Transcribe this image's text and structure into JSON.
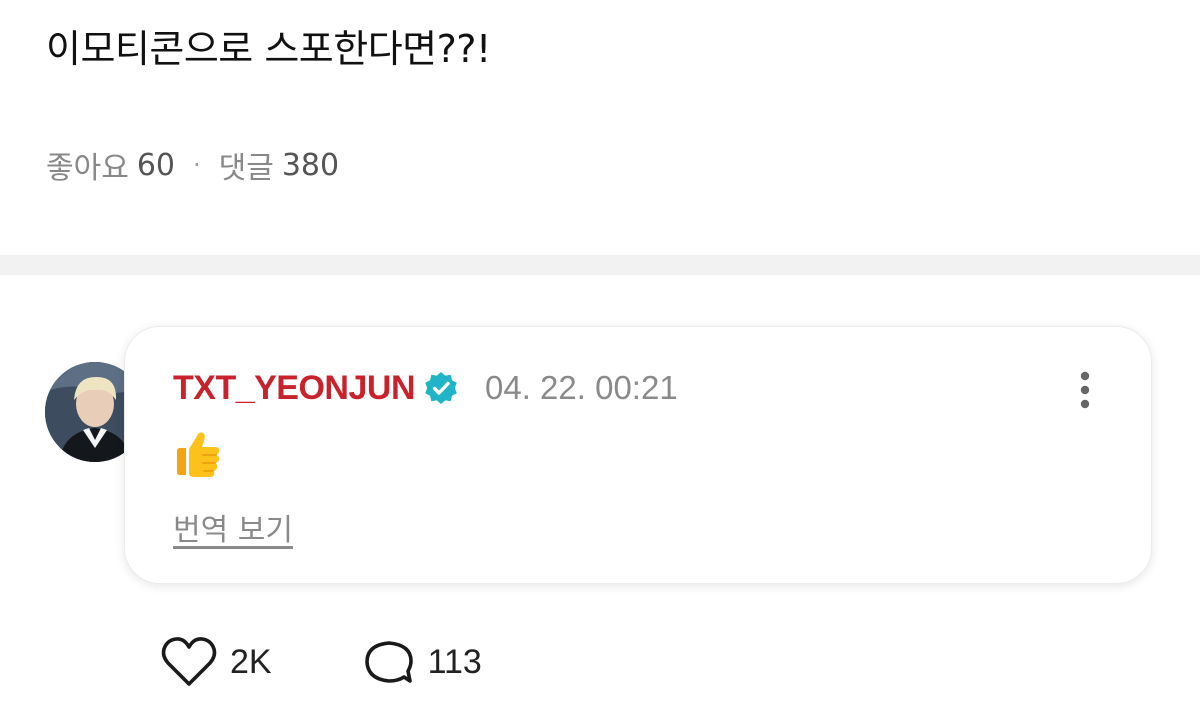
{
  "post": {
    "title": "이모티콘으로 스포한다면??!",
    "likes_label": "좋아요",
    "likes_count": "60",
    "separator": "·",
    "comments_label": "댓글",
    "comments_count": "380"
  },
  "comment": {
    "author": "TXT_YEONJUN",
    "verified": true,
    "timestamp": "04. 22. 00:21",
    "body_emoji": "thumbs-up",
    "translate_label": "번역 보기",
    "actions": {
      "likes": "2K",
      "replies": "113"
    }
  },
  "colors": {
    "author": "#c8232c",
    "verified_badge": "#1fb5c6",
    "muted_text": "#8a8a8a",
    "divider": "#f2f2f2"
  },
  "icons": [
    "verified-badge-icon",
    "more-vertical-icon",
    "thumbs-up-icon",
    "heart-icon",
    "comment-bubble-icon"
  ]
}
